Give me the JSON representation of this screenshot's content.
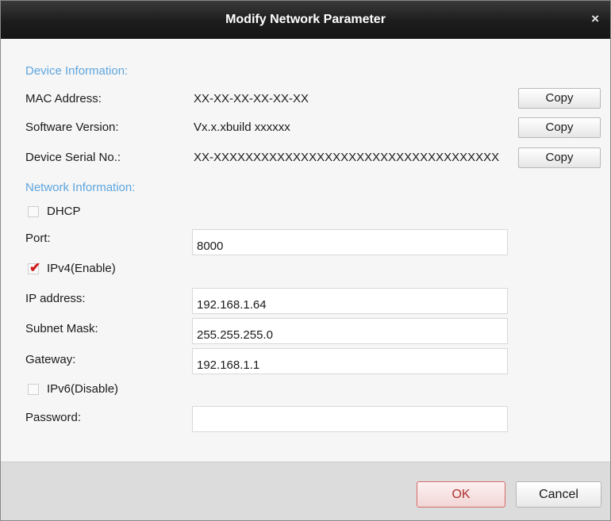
{
  "window": {
    "title": "Modify Network Parameter",
    "close_glyph": "×",
    "close_icon": "close-icon"
  },
  "device_info": {
    "section_label": "Device Information:",
    "rows": [
      {
        "label": "MAC Address:",
        "value": "XX-XX-XX-XX-XX-XX",
        "copy_label": "Copy"
      },
      {
        "label": "Software Version:",
        "value": "Vx.x.xbuild xxxxxx",
        "copy_label": "Copy"
      },
      {
        "label": "Device Serial No.:",
        "value": "XX-XXXXXXXXXXXXXXXXXXXXXXXXXXXXXXXXXXXX",
        "copy_label": "Copy"
      }
    ]
  },
  "network_info": {
    "section_label": "Network Information:",
    "dhcp": {
      "label": "DHCP",
      "checked": false
    },
    "port": {
      "label": "Port:",
      "value": "8000"
    },
    "ipv4": {
      "label": "IPv4(Enable)",
      "checked": true
    },
    "ip_address": {
      "label": "IP address:",
      "value": "192.168.1.64"
    },
    "subnet_mask": {
      "label": "Subnet Mask:",
      "value": "255.255.255.0"
    },
    "gateway": {
      "label": "Gateway:",
      "value": "192.168.1.1"
    },
    "ipv6": {
      "label": "IPv6(Disable)",
      "checked": false
    },
    "password": {
      "label": "Password:",
      "value": ""
    }
  },
  "footer": {
    "ok_label": "OK",
    "cancel_label": "Cancel"
  },
  "colors": {
    "section_heading": "#5da5de",
    "title_bar": "#1c1c1c",
    "checkmark": "#d21c1c",
    "ok_border": "#d86a6a"
  }
}
